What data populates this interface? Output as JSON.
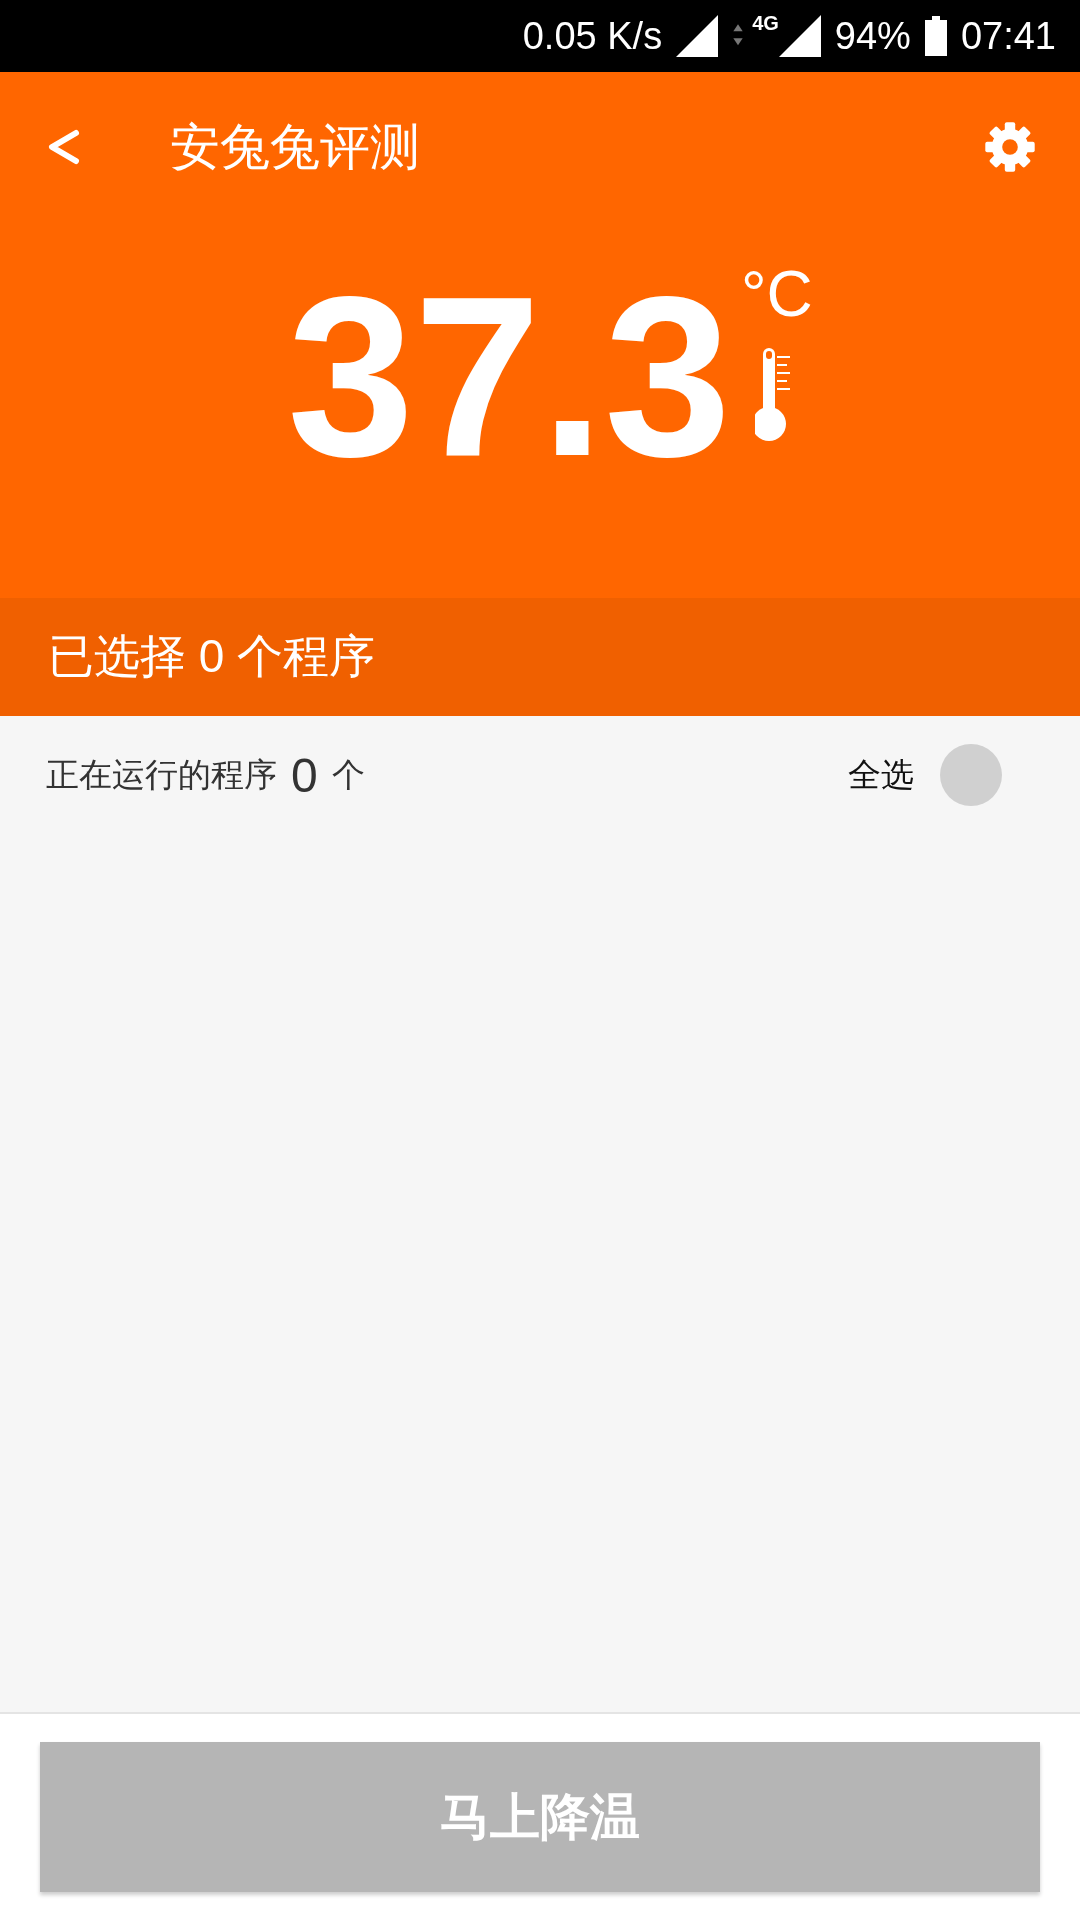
{
  "status_bar": {
    "speed": "0.05 K/s",
    "network": "4G",
    "battery": "94%",
    "time": "07:41"
  },
  "toolbar": {
    "title": "安兔兔评测"
  },
  "temperature": {
    "value": "37.3",
    "unit": "°C"
  },
  "selected_summary": "已选择 0 个程序",
  "running": {
    "label": "正在运行的程序",
    "count": "0",
    "unit": "个",
    "select_all": {
      "label": "全选",
      "checked": false
    }
  },
  "cool_button": {
    "label": "马上降温",
    "disabled": true
  }
}
